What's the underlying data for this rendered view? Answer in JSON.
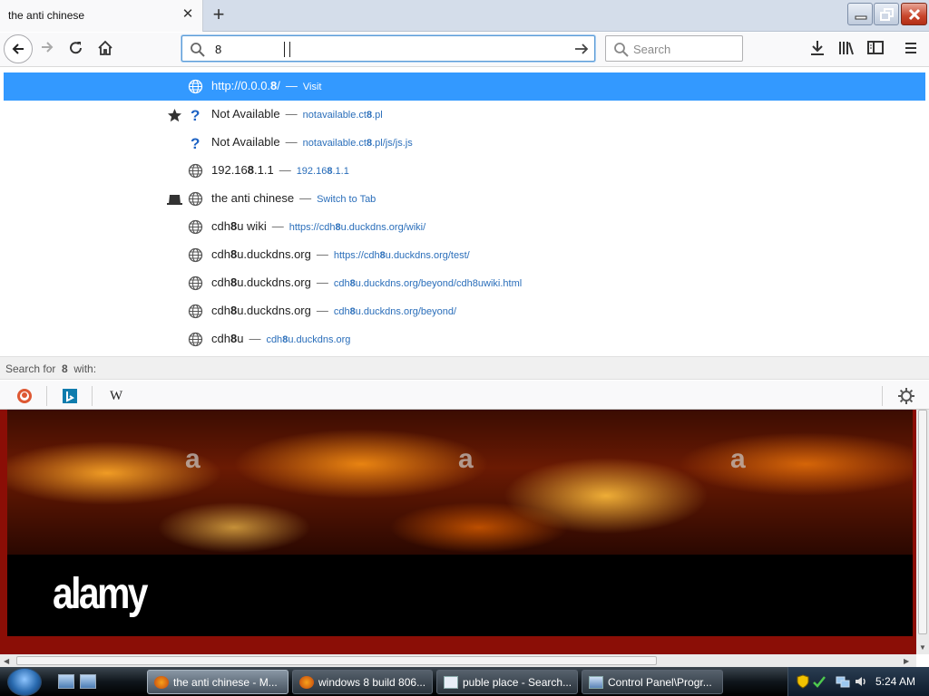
{
  "window": {
    "tab_title": "the anti chinese",
    "tab_close": "✕",
    "new_tab": "+"
  },
  "urlbar": {
    "value": "8"
  },
  "searchbar": {
    "placeholder": "Search"
  },
  "autocomplete": {
    "rows": [
      {
        "pre": "http://0.0.0.",
        "bold": "8",
        "post": "/",
        "sep": "—",
        "sub_pre": "Visit",
        "sub_bold": "",
        "sub_post": "",
        "icon": "globe-icon",
        "type": ""
      },
      {
        "pre": "Not Available",
        "bold": "",
        "post": "",
        "sep": "—",
        "sub_pre": "notavailable.ct",
        "sub_bold": "8",
        "sub_post": ".pl",
        "icon": "question-icon",
        "type": "bookmark-star-icon"
      },
      {
        "pre": "Not Available",
        "bold": "",
        "post": "",
        "sep": "—",
        "sub_pre": "notavailable.ct",
        "sub_bold": "8",
        "sub_post": ".pl/js/js.js",
        "icon": "question-icon",
        "type": ""
      },
      {
        "pre": "192.16",
        "bold": "8",
        "post": ".1.1",
        "sep": "—",
        "sub_pre": "192.16",
        "sub_bold": "8",
        "sub_post": ".1.1",
        "icon": "globe-icon",
        "type": ""
      },
      {
        "pre": "the anti chinese",
        "bold": "",
        "post": "",
        "sep": "—",
        "sub_pre": "Switch to Tab",
        "sub_bold": "",
        "sub_post": "",
        "icon": "globe-icon",
        "type": "open-tab-icon"
      },
      {
        "pre": "cdh",
        "bold": "8",
        "post": "u wiki",
        "sep": "—",
        "sub_pre": "https://cdh",
        "sub_bold": "8",
        "sub_post": "u.duckdns.org/wiki/",
        "icon": "globe-icon",
        "type": ""
      },
      {
        "pre": "cdh",
        "bold": "8",
        "post": "u.duckdns.org",
        "sep": "—",
        "sub_pre": "https://cdh",
        "sub_bold": "8",
        "sub_post": "u.duckdns.org/test/",
        "icon": "globe-icon",
        "type": ""
      },
      {
        "pre": "cdh",
        "bold": "8",
        "post": "u.duckdns.org",
        "sep": "—",
        "sub_pre": "cdh",
        "sub_bold": "8",
        "sub_post": "u.duckdns.org/beyond/cdh8uwiki.html",
        "icon": "globe-icon",
        "type": ""
      },
      {
        "pre": "cdh",
        "bold": "8",
        "post": "u.duckdns.org",
        "sep": "—",
        "sub_pre": "cdh",
        "sub_bold": "8",
        "sub_post": "u.duckdns.org/beyond/",
        "icon": "globe-icon",
        "type": ""
      },
      {
        "pre": "cdh",
        "bold": "8",
        "post": "u",
        "sep": "—",
        "sub_pre": "cdh",
        "sub_bold": "8",
        "sub_post": "u.duckdns.org",
        "icon": "globe-icon",
        "type": ""
      }
    ],
    "search_with_prefix": "Search for",
    "search_with_term": "8",
    "search_with_suffix": "with:"
  },
  "engines": {
    "wikipedia_glyph": "W"
  },
  "content": {
    "watermark": "a",
    "logo": "alamy"
  },
  "taskbar": {
    "tasks": [
      {
        "label": "the anti chinese - M...",
        "active": true
      },
      {
        "label": "windows 8 build 806...",
        "active": false
      },
      {
        "label": "puble place - Search...",
        "active": false
      },
      {
        "label": "Control Panel\\Progr...",
        "active": false
      }
    ],
    "clock": "5:24 AM"
  },
  "colors": {
    "selection": "#3399ff",
    "url_blue": "#2a6eba",
    "page_red": "#8b0e06"
  }
}
